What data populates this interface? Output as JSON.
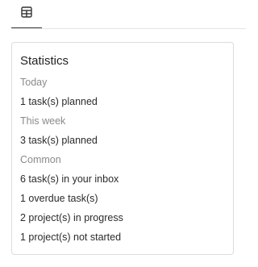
{
  "tabs": [
    {
      "icon": "dashboard-icon",
      "active": true
    }
  ],
  "statistics": {
    "title": "Statistics",
    "sections": [
      {
        "label": "Today",
        "lines": [
          "1 task(s) planned"
        ]
      },
      {
        "label": "This week",
        "lines": [
          "3 task(s) planned"
        ]
      },
      {
        "label": "Common",
        "lines": [
          "6 task(s) in your inbox",
          "1 overdue task(s)",
          "2 project(s) in progress",
          "1 project(s) not started"
        ]
      }
    ]
  }
}
